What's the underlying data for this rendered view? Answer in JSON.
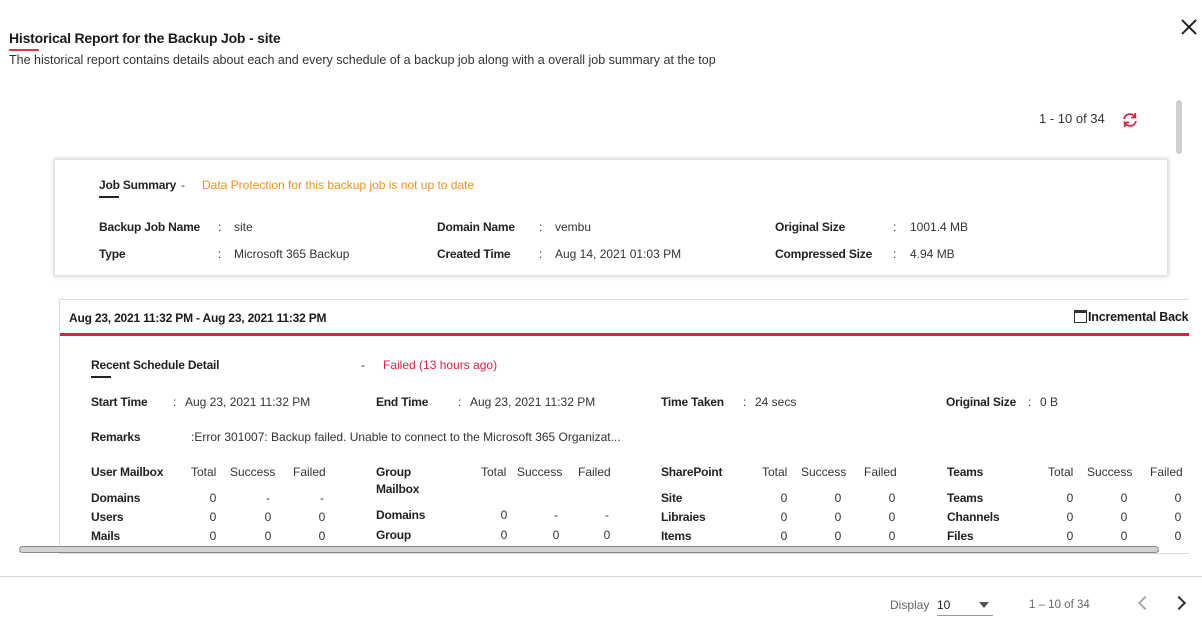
{
  "header": {
    "title": "Historical Report for the Backup Job - site",
    "subtitle": "The historical report contains details about each and every schedule of a backup job along with a overall job summary at the top"
  },
  "icons": {
    "close": "close-icon",
    "refresh": "refresh-icon",
    "calendar": "calendar-icon",
    "prev": "chevron-left-icon",
    "next": "chevron-right-icon"
  },
  "colors": {
    "accent_red": "#d9223f",
    "warning_orange": "#f0901e",
    "title_underline": "#e0394a"
  },
  "top_pager": {
    "text": "1 - 10 of 34"
  },
  "job_summary": {
    "label": "Job Summary",
    "separator": "-",
    "status": "Data Protection for this backup job is not up to date",
    "fields": {
      "backup_job_name": {
        "label": "Backup Job Name",
        "value": "site"
      },
      "type": {
        "label": "Type",
        "value": "Microsoft 365 Backup"
      },
      "domain_name": {
        "label": "Domain Name",
        "value": "vembu"
      },
      "created_time": {
        "label": "Created Time",
        "value": "Aug 14, 2021 01:03 PM"
      },
      "original_size": {
        "label": "Original Size",
        "value": "1001.4 MB"
      },
      "compressed_size": {
        "label": "Compressed Size",
        "value": "4.94 MB"
      }
    }
  },
  "schedule": {
    "range": "Aug 23, 2021 11:32 PM - Aug 23, 2021 11:32 PM",
    "type": "Incremental Backu",
    "recent_label": "Recent Schedule Detail",
    "separator": "-",
    "status": "Failed  (13 hours ago)",
    "start_time": {
      "label": "Start Time",
      "value": "Aug 23, 2021 11:32 PM"
    },
    "end_time": {
      "label": "End Time",
      "value": "Aug 23, 2021 11:32 PM"
    },
    "time_taken": {
      "label": "Time Taken",
      "value": "24 secs"
    },
    "original_size": {
      "label": "Original Size",
      "value": "0 B"
    },
    "remarks": {
      "label": "Remarks",
      "value": ":Error 301007: Backup failed. Unable to connect to the Microsoft 365 Organizat..."
    },
    "col_headers": {
      "total": "Total",
      "success": "Success",
      "failed": "Failed"
    },
    "user_mailbox": {
      "title": "User Mailbox",
      "rows": [
        {
          "name": "Domains",
          "total": "0",
          "success": "-",
          "failed": "-"
        },
        {
          "name": "Users",
          "total": "0",
          "success": "0",
          "failed": "0"
        },
        {
          "name": "Mails",
          "total": "0",
          "success": "0",
          "failed": "0"
        }
      ]
    },
    "group_mailbox": {
      "title_line1": "Group",
      "title_line2": "Mailbox",
      "rows": [
        {
          "name": "Domains",
          "total": "0",
          "success": "-",
          "failed": "-"
        },
        {
          "name": "Group",
          "total": "0",
          "success": "0",
          "failed": "0"
        }
      ]
    },
    "sharepoint": {
      "title": "SharePoint",
      "rows": [
        {
          "name": "Site",
          "total": "0",
          "success": "0",
          "failed": "0"
        },
        {
          "name": "Libraies",
          "total": "0",
          "success": "0",
          "failed": "0"
        },
        {
          "name": "Items",
          "total": "0",
          "success": "0",
          "failed": "0"
        }
      ]
    },
    "teams": {
      "title": "Teams",
      "rows": [
        {
          "name": "Teams",
          "total": "0",
          "success": "0",
          "failed": "0"
        },
        {
          "name": "Channels",
          "total": "0",
          "success": "0",
          "failed": "0"
        },
        {
          "name": "Files",
          "total": "0",
          "success": "0",
          "failed": "0"
        }
      ]
    }
  },
  "footer": {
    "display_label": "Display",
    "display_value": "10",
    "pager": "1 – 10 of 34"
  }
}
